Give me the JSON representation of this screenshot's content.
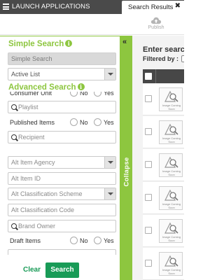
{
  "topbar": {
    "app_title": "LAUNCH APPLICATIONS",
    "tab_label": "Search Results",
    "close_symbol": "✖"
  },
  "toolbar": {
    "publish_label": "Publish",
    "publish_icon": "cloud-upload-icon"
  },
  "left_panel": {
    "simple_search_title": "Simple Search",
    "simple_search_input_placeholder": "Simple Search",
    "list_select_value": "Active List",
    "advanced_search_title": "Advanced Search",
    "consumer_unit": {
      "label": "Consumer Unit",
      "no": "No",
      "yes": "Yes"
    },
    "playlist_placeholder": "Playlist",
    "published_items": {
      "label": "Published Items",
      "no": "No",
      "yes": "Yes"
    },
    "recipient_placeholder": "Recipient",
    "alt_item_agency_value": "Alt Item Agency",
    "alt_item_id_placeholder": "Alt Item ID",
    "alt_classification_scheme_value": "Alt Classification Scheme",
    "alt_classification_code_placeholder": "Alt Classification Code",
    "brand_owner_placeholder": "Brand Owner",
    "draft_items": {
      "label": "Draft Items",
      "no": "No",
      "yes": "Yes"
    },
    "clear_label": "Clear",
    "search_label": "Search"
  },
  "collapse": {
    "arrows": "«",
    "label": "Collapse"
  },
  "right_panel": {
    "enter_search": "Enter search",
    "filtered_by": "Filtered by :",
    "rows": [
      {
        "image_text": "Image Coming Soon"
      },
      {
        "image_text": "Image Coming Soon"
      },
      {
        "image_text": "Image Coming Soon"
      },
      {
        "image_text": "Image Coming Soon"
      },
      {
        "image_text": "Image Coming Soon"
      },
      {
        "image_text": "Image Coming Soon"
      }
    ]
  },
  "colors": {
    "accent_green": "#8dc63f",
    "button_green": "#199b57",
    "topbar_dark": "#4a4a4a",
    "table_header": "#474747"
  }
}
